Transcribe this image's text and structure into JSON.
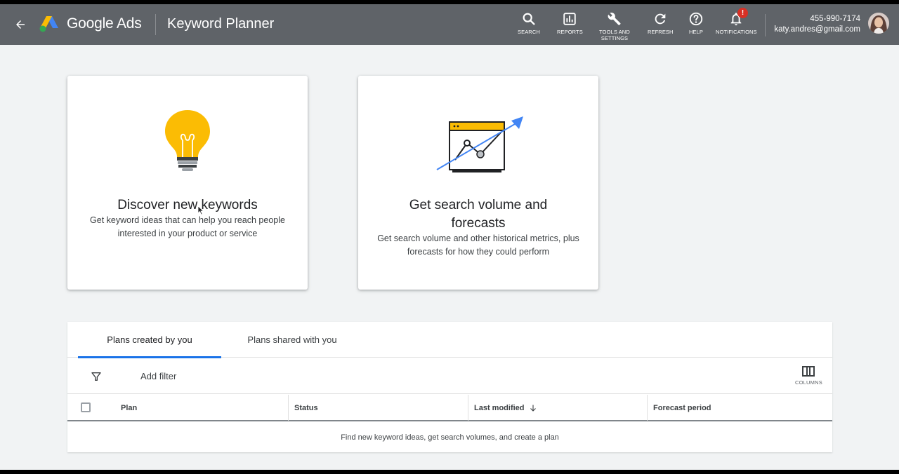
{
  "header": {
    "product": "Google Ads",
    "page_title": "Keyword Planner",
    "tools": [
      {
        "label": "SEARCH",
        "icon": "search-icon"
      },
      {
        "label": "REPORTS",
        "icon": "reports-icon"
      },
      {
        "label": "TOOLS AND SETTINGS",
        "icon": "wrench-icon"
      },
      {
        "label": "REFRESH",
        "icon": "refresh-icon"
      },
      {
        "label": "HELP",
        "icon": "help-icon"
      },
      {
        "label": "NOTIFICATIONS",
        "icon": "bell-icon"
      }
    ],
    "notification_badge": "!",
    "account_id": "455-990-7174",
    "account_email": "katy.andres@gmail.com"
  },
  "cards": {
    "discover": {
      "title": "Discover new keywords",
      "description": "Get keyword ideas that can help you reach people interested in your product or service"
    },
    "forecast": {
      "title": "Get search volume and forecasts",
      "description": "Get search volume and other historical metrics, plus forecasts for how they could perform"
    }
  },
  "plans": {
    "tabs": [
      "Plans created by you",
      "Plans shared with you"
    ],
    "add_filter": "Add filter",
    "columns_label": "COLUMNS",
    "columns": [
      "Plan",
      "Status",
      "Last modified",
      "Forecast period"
    ],
    "empty_message": "Find new keyword ideas, get search volumes, and create a plan"
  },
  "colors": {
    "topbar": "#5f6368",
    "accent": "#1a73e8",
    "bulb": "#fbbc04",
    "badge": "#d93025"
  }
}
